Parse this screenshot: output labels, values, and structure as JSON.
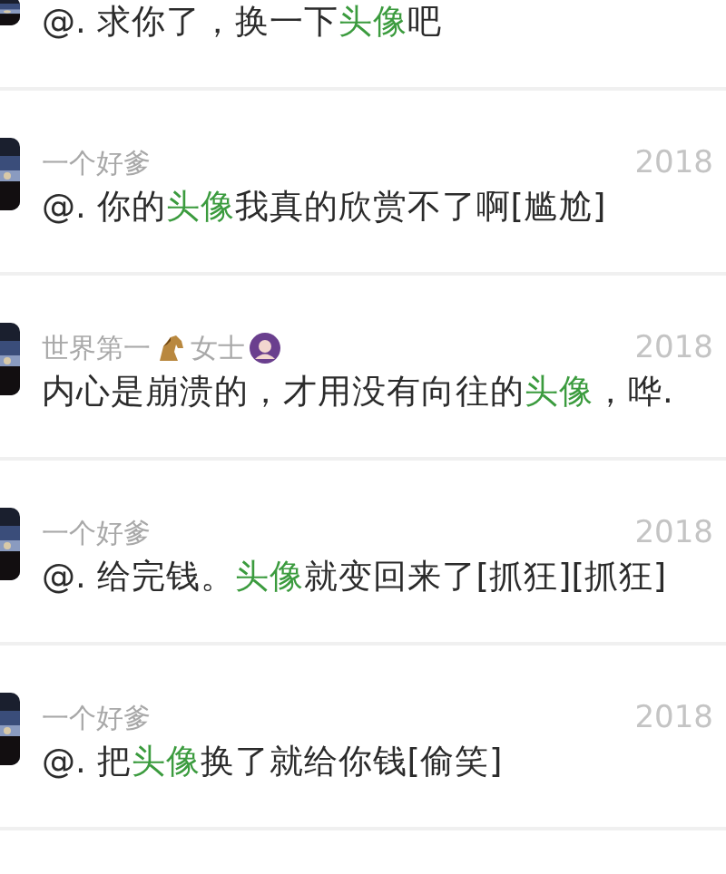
{
  "comments": [
    {
      "message": [
        {
          "text": "@. 求你了，换一下",
          "highlight": false
        },
        {
          "text": "头像",
          "highlight": true
        },
        {
          "text": "吧",
          "highlight": false
        }
      ]
    },
    {
      "date": "2018",
      "name_parts": [
        {
          "kind": "text",
          "text": "一个好爹"
        }
      ],
      "message": [
        {
          "text": "@. 你的",
          "highlight": false
        },
        {
          "text": "头像",
          "highlight": true
        },
        {
          "text": "我真的欣赏不了啊[尴尬]",
          "highlight": false
        }
      ]
    },
    {
      "date": "2018",
      "name_parts": [
        {
          "kind": "text",
          "text": "世界第一"
        },
        {
          "kind": "horse"
        },
        {
          "kind": "text",
          "text": "女士"
        },
        {
          "kind": "badge"
        }
      ],
      "message": [
        {
          "text": "内心是崩溃的，才用没有向往的",
          "highlight": false
        },
        {
          "text": "头像",
          "highlight": true
        },
        {
          "text": "，哗.",
          "highlight": false
        }
      ]
    },
    {
      "date": "2018",
      "name_parts": [
        {
          "kind": "text",
          "text": "一个好爹"
        }
      ],
      "message": [
        {
          "text": "@. 给完钱。",
          "highlight": false
        },
        {
          "text": "头像",
          "highlight": true
        },
        {
          "text": "就变回来了[抓狂][抓狂]",
          "highlight": false
        }
      ]
    },
    {
      "date": "2018",
      "name_parts": [
        {
          "kind": "text",
          "text": "一个好爹"
        }
      ],
      "message": [
        {
          "text": "@. 把",
          "highlight": false
        },
        {
          "text": "头像",
          "highlight": true
        },
        {
          "text": "换了就给你钱[偷笑]",
          "highlight": false
        }
      ]
    }
  ]
}
